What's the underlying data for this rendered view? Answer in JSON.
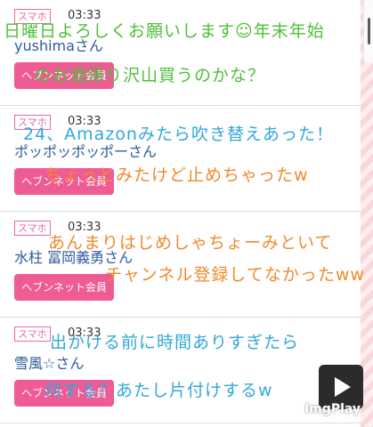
{
  "entries": [
    {
      "tag": "スマホ",
      "time": "03:33",
      "name": "yushimaさん",
      "badge": "ヘブンネット会員"
    },
    {
      "tag": "スマホ",
      "time": "03:33",
      "name": "ポッポッポッポーさん",
      "badge": "ヘブンネット会員"
    },
    {
      "tag": "スマホ",
      "time": "03:33",
      "name": "水柱 冨岡義勇さん",
      "badge": "ヘブンネット会員"
    },
    {
      "tag": "スマホ",
      "time": "03:33",
      "name": "雪風☆さん",
      "badge": "ヘブンネット会員"
    }
  ],
  "comments": [
    "日曜日よろしくお願いします☺年末年始",
    "のお酒帰り沢山買うのかな？",
    "24、Amazonみたら吹き替えあった！",
    "ちょっとみたけど止めちゃったw",
    "あんまりはじめしゃちょーみといて",
    "チャンネル登録してなかったww",
    "出かける前に時間ありすぎたら",
    "何する？あたし片付けするw"
  ],
  "watermark": "ImgPlay",
  "colors": {
    "accent": "#ef5b94",
    "name": "#2e5b9e"
  },
  "icons": {
    "video": "play-icon"
  }
}
